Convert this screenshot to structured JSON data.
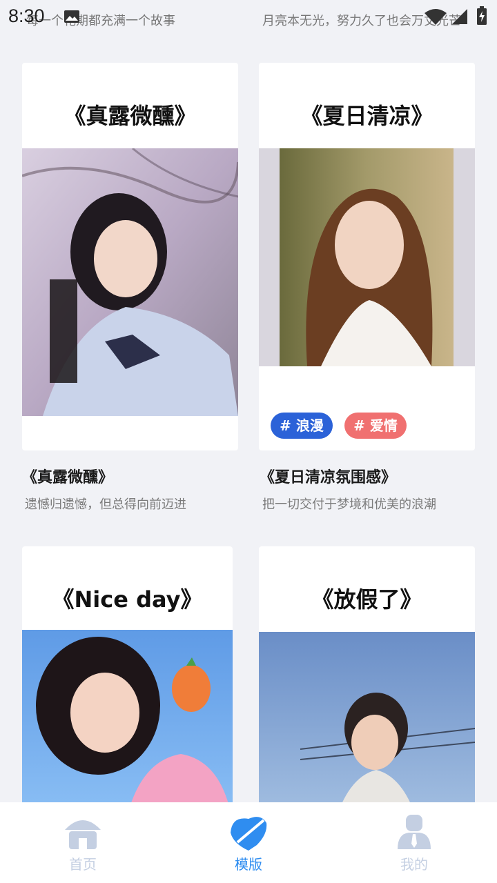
{
  "status_bar": {
    "time": "8:30",
    "marquee_left": "每一个花期都充满一个故事",
    "marquee_right": "月亮本无光，努力久了也会万丈光芒"
  },
  "cards": [
    {
      "title": "《真露微醺》",
      "caption_title": "《真露微醺》",
      "caption_sub": "遗憾归遗憾，但总得向前迈进"
    },
    {
      "title": "《夏日清凉》",
      "caption_title": "《夏日清凉氛围感》",
      "caption_sub": "把一切交付于梦境和优美的浪潮",
      "tags": [
        {
          "label": "# 浪漫",
          "color": "#2b62d8"
        },
        {
          "label": "# 爱情",
          "color": "#f07070"
        }
      ]
    },
    {
      "title": "《Nice day》"
    },
    {
      "title": "《放假了》"
    }
  ],
  "nav": {
    "items": [
      {
        "label": "首页",
        "icon": "home-icon",
        "active": false
      },
      {
        "label": "模版",
        "icon": "template-icon",
        "active": true
      },
      {
        "label": "我的",
        "icon": "profile-icon",
        "active": false
      }
    ],
    "active_color": "#2f8df0",
    "inactive_color": "#c4cfe2"
  }
}
